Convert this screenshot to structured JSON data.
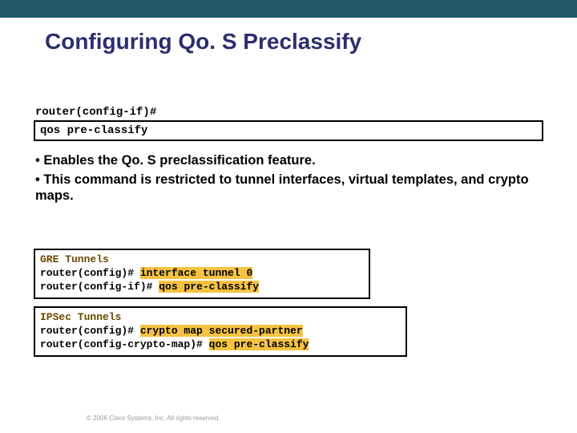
{
  "title": "Configuring Qo. S Preclassify",
  "prompt": "router(config-if)#",
  "command": "qos pre-classify",
  "bullets": [
    "Enables the Qo. S preclassification feature.",
    "This command is restricted to tunnel interfaces, virtual templates, and crypto maps."
  ],
  "example1": {
    "label": "GRE Tunnels",
    "line1_prompt": "router(config)# ",
    "line1_cmd": "interface tunnel 0",
    "line2_prompt": "router(config-if)# ",
    "line2_cmd": "qos pre-classify"
  },
  "example2": {
    "label": "IPSec Tunnels",
    "line1_prompt": "router(config)# ",
    "line1_cmd": "crypto map secured-partner",
    "line2_prompt": "router(config-crypto-map)# ",
    "line2_cmd": "qos pre-classify"
  },
  "footer": "© 2006 Cisco Systems, Inc. All rights reserved."
}
